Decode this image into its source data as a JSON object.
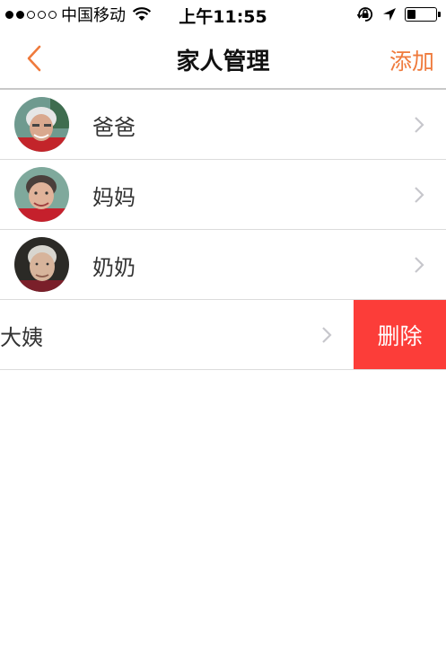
{
  "status_bar": {
    "carrier": "中国移动",
    "time": "上午11:55",
    "signal_bars_filled": 2,
    "signal_bars_total": 5,
    "battery_level": 0.3,
    "icons": [
      "wifi-icon",
      "orientation-lock-icon",
      "location-arrow-icon",
      "battery-icon"
    ]
  },
  "nav": {
    "title": "家人管理",
    "back_icon": "chevron-left-icon",
    "action_label": "添加"
  },
  "members": [
    {
      "name": "爸爸",
      "has_avatar": true
    },
    {
      "name": "妈妈",
      "has_avatar": true
    },
    {
      "name": "奶奶",
      "has_avatar": true
    },
    {
      "name": "大姨",
      "has_avatar": false,
      "swiped": true
    }
  ],
  "delete_label": "删除",
  "colors": {
    "accent": "#ef7a3c",
    "delete": "#fc3d39",
    "divider": "#dcdcdc",
    "chevron": "#c7c7cc"
  }
}
